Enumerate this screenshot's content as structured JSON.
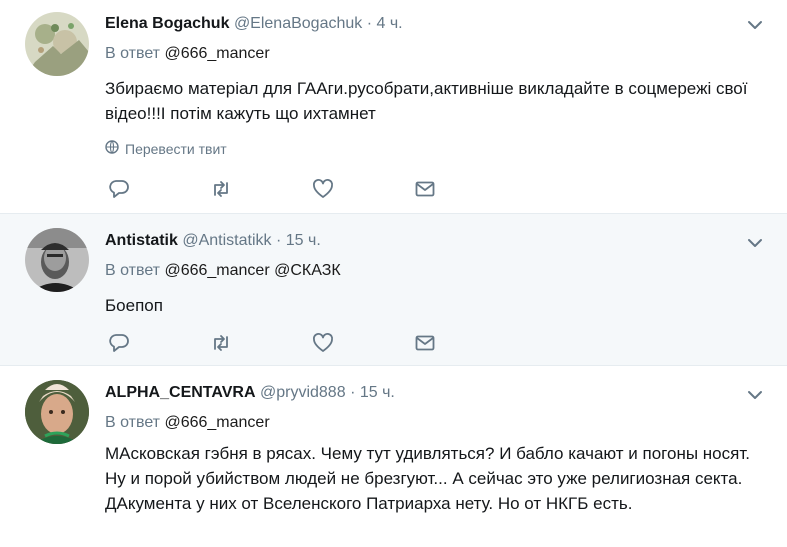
{
  "tweets": [
    {
      "name": "Elena Bogachuk",
      "handle": "@ElenaBogachuk",
      "dot": "·",
      "time": "4 ч.",
      "reply_prefix": "В ответ",
      "mentions": [
        "@666_mancer"
      ],
      "text": "Збираємо матеріал для ГААги.русобрати,активніше викладайте в соцмережі свої відео!!!І потім кажуть що ихтамнет",
      "translate": "Перевести твит"
    },
    {
      "name": "Antistatik",
      "handle": "@Antistatikk",
      "dot": "·",
      "time": "15 ч.",
      "reply_prefix": "В ответ",
      "mentions": [
        "@666_mancer",
        "@СКАЗК"
      ],
      "text": "Боепоп"
    },
    {
      "name": "ALPHA_CENTAVRA",
      "handle": "@pryvid888",
      "dot": "·",
      "time": "15 ч.",
      "reply_prefix": "В ответ",
      "mentions": [
        "@666_mancer"
      ],
      "text": "МАсковская гэбня в рясах. Чему тут удивляться? И бабло качают и погоны носят. Ну и порой убийством людей не брезгуют... А сейчас это уже религиозная секта. ДАкумента у них от Вселенского Патриарха нету. Но от НКГБ есть."
    }
  ],
  "icons": {
    "reply": "reply-icon",
    "retweet": "retweet-icon",
    "like": "like-icon",
    "message": "message-icon",
    "caret": "chevron-down-icon",
    "globe": "globe-icon"
  },
  "colors": {
    "icon": "#657786",
    "highlight_bg": "#f5f8fa",
    "mention": "#5c4c31"
  }
}
